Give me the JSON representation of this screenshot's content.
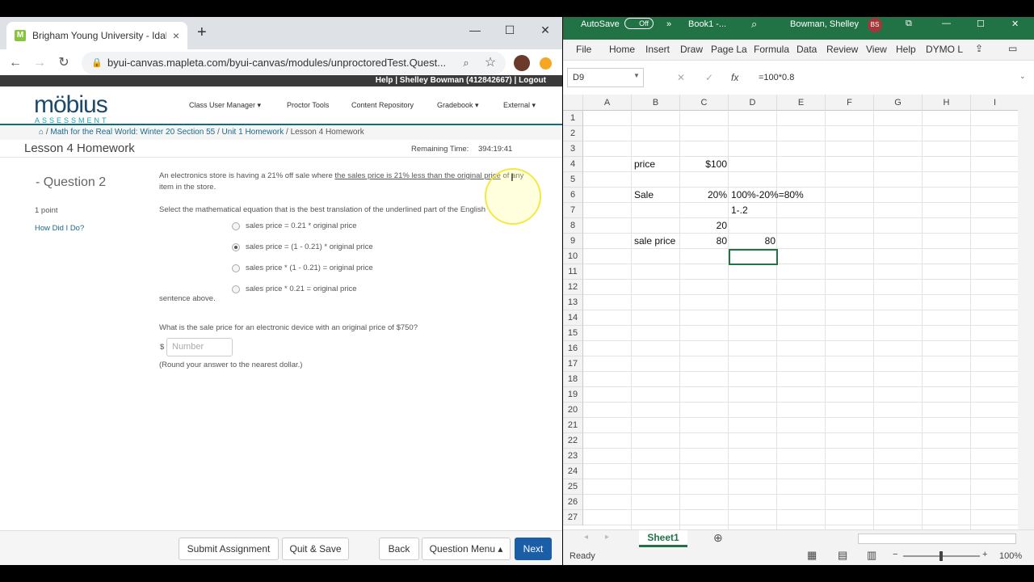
{
  "browser": {
    "tab_title": "Brigham Young University - Idah",
    "tab_close": "×",
    "new_tab": "+",
    "url": "byui-canvas.mapleta.com/byui-canvas/modules/unproctoredTest.Quest..."
  },
  "mobius": {
    "header_links": "Help | Shelley Bowman (412842667) | Logout",
    "logo": "möbius",
    "logo_sub": "ASSESSMENT",
    "menu": [
      "Class User Manager ▾",
      "Proctor Tools",
      "Content Repository",
      "Gradebook ▾",
      "External ▾"
    ],
    "breadcrumb": [
      "Math for the Real World: Winter 20 Section 55",
      "Unit 1 Homework",
      "Lesson 4 Homework"
    ],
    "page_title": "Lesson 4 Homework",
    "remaining_time_label": "Remaining Time:",
    "remaining_time": "394:19:41",
    "question_label": "- Question 2",
    "points": "1 point",
    "how_did_i_do": "How Did I Do?",
    "question_intro": "An electronics store is having a 21% off sale where ",
    "question_underlined": "the sales price is 21% less than the original price",
    "question_outro": " of any item in the store.",
    "instruction": "Select the mathematical equation that is the best translation of the underlined part of the English",
    "options": [
      {
        "label": "sales price = 0.21 * original price",
        "selected": false
      },
      {
        "label": "sales price = (1 - 0.21) * original price",
        "selected": true
      },
      {
        "label": "sales price * (1 - 0.21) = original price",
        "selected": false
      },
      {
        "label": "sales price * 0.21 = original price",
        "selected": false
      }
    ],
    "instruction_end": "sentence above.",
    "question2": "What is the sale price for an electronic device with an original price of $750?",
    "currency": "$",
    "input_placeholder": "Number",
    "round_note": "(Round your answer to the nearest dollar.)",
    "buttons": {
      "submit": "Submit Assignment",
      "quit": "Quit & Save",
      "back": "Back",
      "menu": "Question Menu ▴",
      "next": "Next"
    }
  },
  "excel": {
    "autosave": "AutoSave",
    "autosave_state": "Off",
    "book": "Book1 -...",
    "user": "Bowman, Shelley",
    "initials": "BS",
    "ribbon_tabs": [
      "File",
      "Home",
      "Insert",
      "Draw",
      "Page La",
      "Formula",
      "Data",
      "Review",
      "View",
      "Help",
      "DYMO L"
    ],
    "name_box": "D9",
    "fx": "fx",
    "formula": "=100*0.8",
    "columns": [
      "A",
      "B",
      "C",
      "D",
      "E",
      "F",
      "G",
      "H",
      "I"
    ],
    "rows": [
      "1",
      "2",
      "3",
      "4",
      "5",
      "6",
      "7",
      "8",
      "9",
      "10",
      "11",
      "12",
      "13",
      "14",
      "15",
      "16",
      "17",
      "18",
      "19",
      "20",
      "21",
      "22",
      "23",
      "24",
      "25",
      "26",
      "27"
    ],
    "cells": {
      "B4": "price",
      "C4": "$100",
      "B6": "Sale",
      "C6": "20%",
      "D6": "100%-20%=80%",
      "D7": "1-.2",
      "C8": "20",
      "B9": "sale price",
      "C9": "80",
      "D9": "80"
    },
    "sheet_tab": "Sheet1",
    "status": "Ready",
    "zoom": "100%"
  },
  "colors": {
    "excel_green": "#217346",
    "mobius_teal": "#0e6e7e",
    "next_blue": "#1a5ea8"
  }
}
